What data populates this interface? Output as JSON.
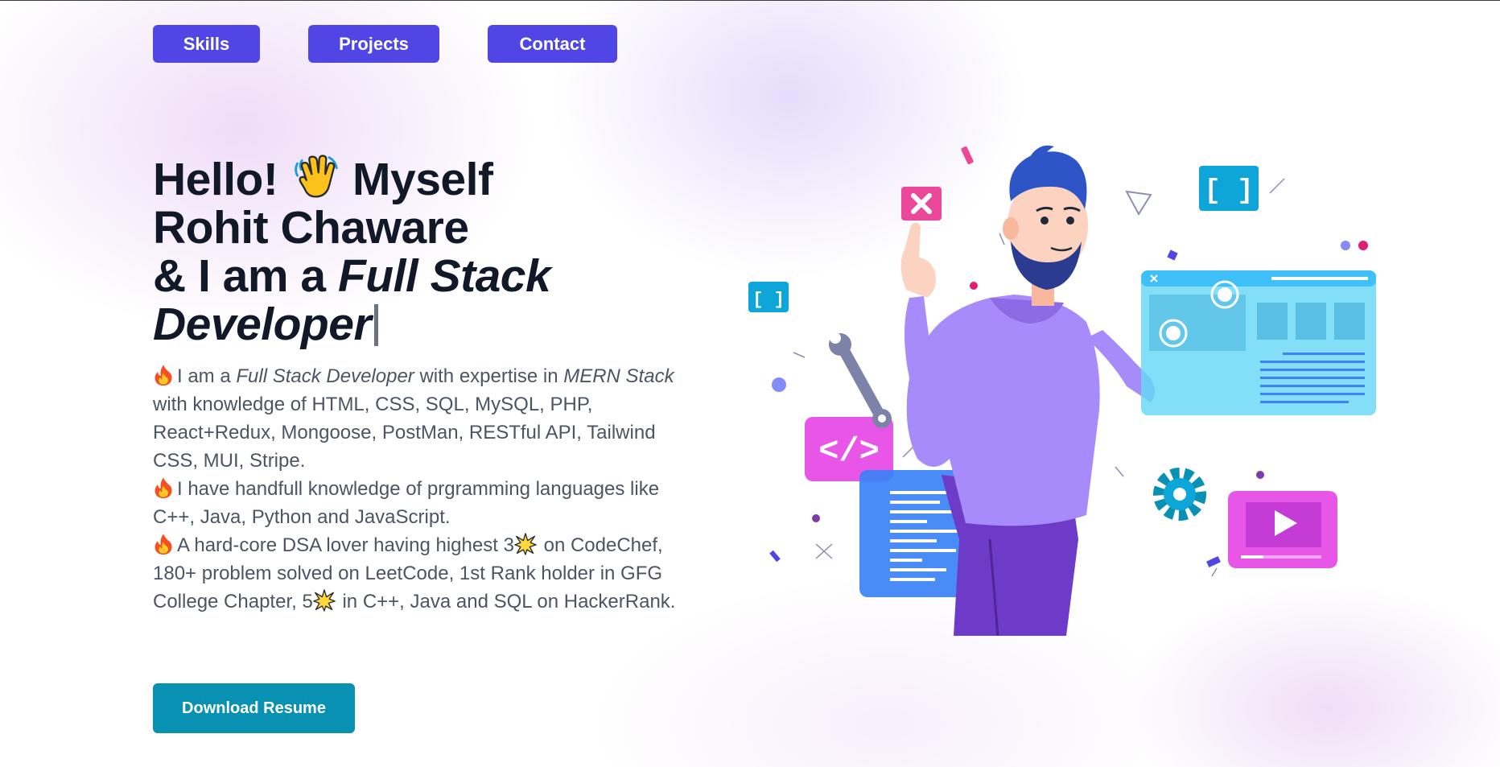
{
  "nav": {
    "skills_label": "Skills",
    "projects_label": "Projects",
    "contact_label": "Contact"
  },
  "hero": {
    "line1_before": "Hello!",
    "line1_after": "Myself",
    "line2": "Rohit Chaware",
    "line3_prefix": "& I am a ",
    "role": "Full Stack Developer"
  },
  "bio": {
    "p1": {
      "text_a": "I am a ",
      "em_a": "Full Stack Developer",
      "text_b": " with expertise in ",
      "em_b": "MERN Stack",
      "text_c": " with knowledge of HTML, CSS, SQL, MySQL, PHP, React+Redux, Mongoose, PostMan, RESTful API, Tailwind CSS, MUI, Stripe."
    },
    "p2": "I have handfull knowledge of prgramming languages like C++, Java, Python and JavaScript.",
    "p3": {
      "text_a": "A hard-core DSA lover having highest 3",
      "text_b": " on CodeChef, 180+ problem solved on LeetCode, 1st Rank holder in GFG College Chapter, 5",
      "text_c": " in C++, Java and SQL on HackerRank."
    }
  },
  "resume_button_label": "Download Resume",
  "colors": {
    "nav_button": "#4f46e5",
    "resume_button": "#0891b2",
    "title_text": "#111827",
    "body_text": "#4b5563"
  },
  "icons": {
    "wave": "waving-hand-icon",
    "fire": "fire-icon",
    "star": "star-icon"
  }
}
